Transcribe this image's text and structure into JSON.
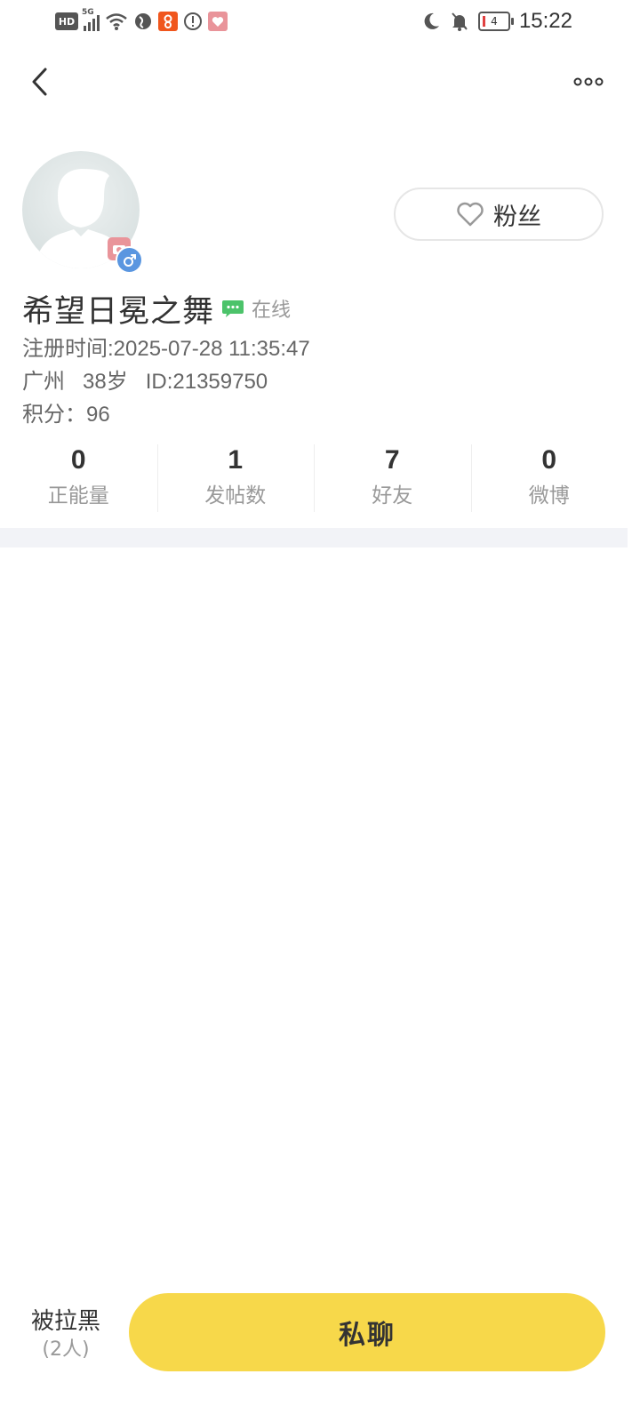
{
  "status_bar": {
    "hd_label": "HD",
    "network_label": "5G",
    "battery_level": "4",
    "time": "15:22"
  },
  "nav": {
    "back_icon": "chevron-left-icon",
    "more_icon": "more-dots-icon"
  },
  "profile": {
    "username": "希望日冕之舞",
    "online_status": "在线",
    "register_line": "注册时间:2025-07-28 11:35:47",
    "detail_line": "广州   38岁   ID:21359750",
    "points_line": "积分：96",
    "gender": "male",
    "follow_button_label": "粉丝"
  },
  "stats": [
    {
      "value": "0",
      "label": "正能量"
    },
    {
      "value": "1",
      "label": "发帖数"
    },
    {
      "value": "7",
      "label": "好友"
    },
    {
      "value": "0",
      "label": "微博"
    }
  ],
  "bottom_bar": {
    "blacklist_label": "被拉黑",
    "blacklist_count": "(2人)",
    "chat_button_label": "私聊"
  },
  "colors": {
    "accent_yellow": "#f7d84a",
    "gender_blue": "#5a96e0",
    "online_green": "#4cc36a",
    "band_gray": "#f2f3f7"
  }
}
